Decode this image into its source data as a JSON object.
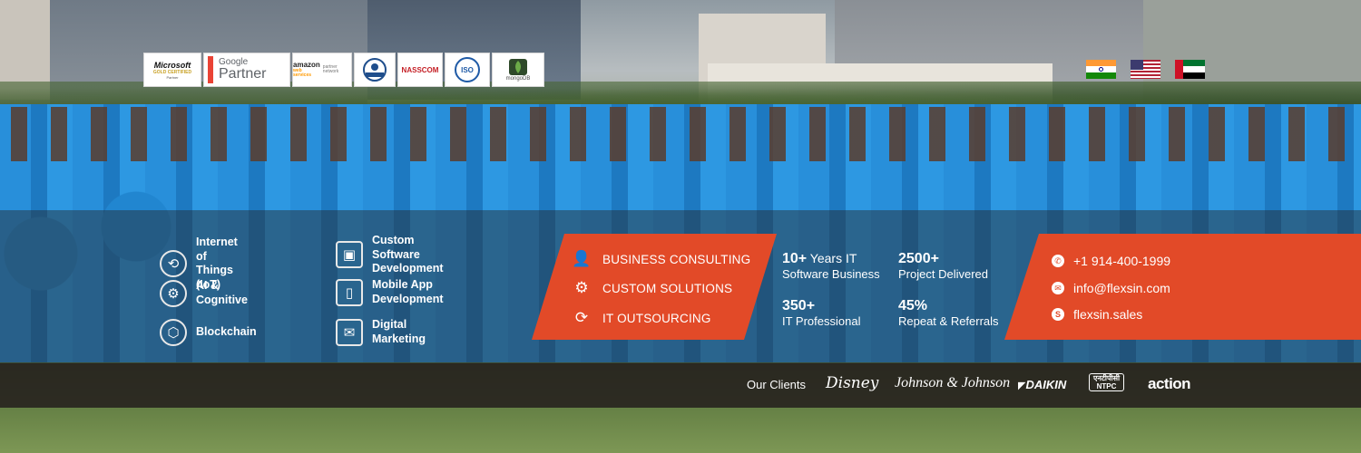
{
  "partners": {
    "microsoft": {
      "name": "Microsoft",
      "line2": "GOLD CERTIFIED",
      "line3": "Partner"
    },
    "google": {
      "name": "Google",
      "tag": "Partner"
    },
    "amazon": {
      "name": "amazon",
      "sub": "web services",
      "tag": "partner network"
    },
    "nasscom": "NASSCOM",
    "iso": "ISO",
    "mongodb": "mongoDB"
  },
  "flags": [
    "india-flag",
    "usa-flag",
    "uae-flag"
  ],
  "services": [
    {
      "icon": "iot-icon",
      "glyph": "⟲",
      "label_line1": "Internet of Things",
      "label_line2": "(IoT)"
    },
    {
      "icon": "custom-software-icon",
      "glyph": "▣",
      "label_line1": "Custom Software",
      "label_line2": "Development"
    },
    {
      "icon": "ai-cognitive-icon",
      "glyph": "⚙",
      "label_line1": "AI & Cognitive",
      "label_line2": ""
    },
    {
      "icon": "mobile-app-icon",
      "glyph": "▯",
      "label_line1": "Mobile App Development",
      "label_line2": ""
    },
    {
      "icon": "blockchain-icon",
      "glyph": "⬡",
      "label_line1": "Blockchain",
      "label_line2": ""
    },
    {
      "icon": "digital-marketing-icon",
      "glyph": "✉",
      "label_line1": "Digital Marketing",
      "label_line2": ""
    }
  ],
  "offerings": [
    {
      "icon": "consulting-icon",
      "glyph": "👤",
      "label": "BUSINESS CONSULTING"
    },
    {
      "icon": "gears-icon",
      "glyph": "⚙",
      "label": "CUSTOM SOLUTIONS"
    },
    {
      "icon": "outsourcing-icon",
      "glyph": "⟳",
      "label": "IT OUTSOURCING"
    }
  ],
  "stats": [
    {
      "number": "10+",
      "unit": " Years IT",
      "caption": "Software Business"
    },
    {
      "number": "2500+",
      "unit": "",
      "caption": "Project Delivered"
    },
    {
      "number": "350+",
      "unit": "",
      "caption": "IT Professional"
    },
    {
      "number": "45%",
      "unit": "",
      "caption": "Repeat & Referrals"
    }
  ],
  "contact": {
    "phone": "+1 914-400-1999",
    "email": "info@flexsin.com",
    "skype": "flexsin.sales"
  },
  "clients": {
    "title": "Our Clients",
    "names": [
      "Disney",
      "Johnson & Johnson",
      "DAIKIN",
      "NTPC",
      "action"
    ],
    "ntpc_hindi": "एनटीपीसी"
  },
  "colors": {
    "accent": "#e24a28",
    "clients_bar": "#26201e"
  }
}
